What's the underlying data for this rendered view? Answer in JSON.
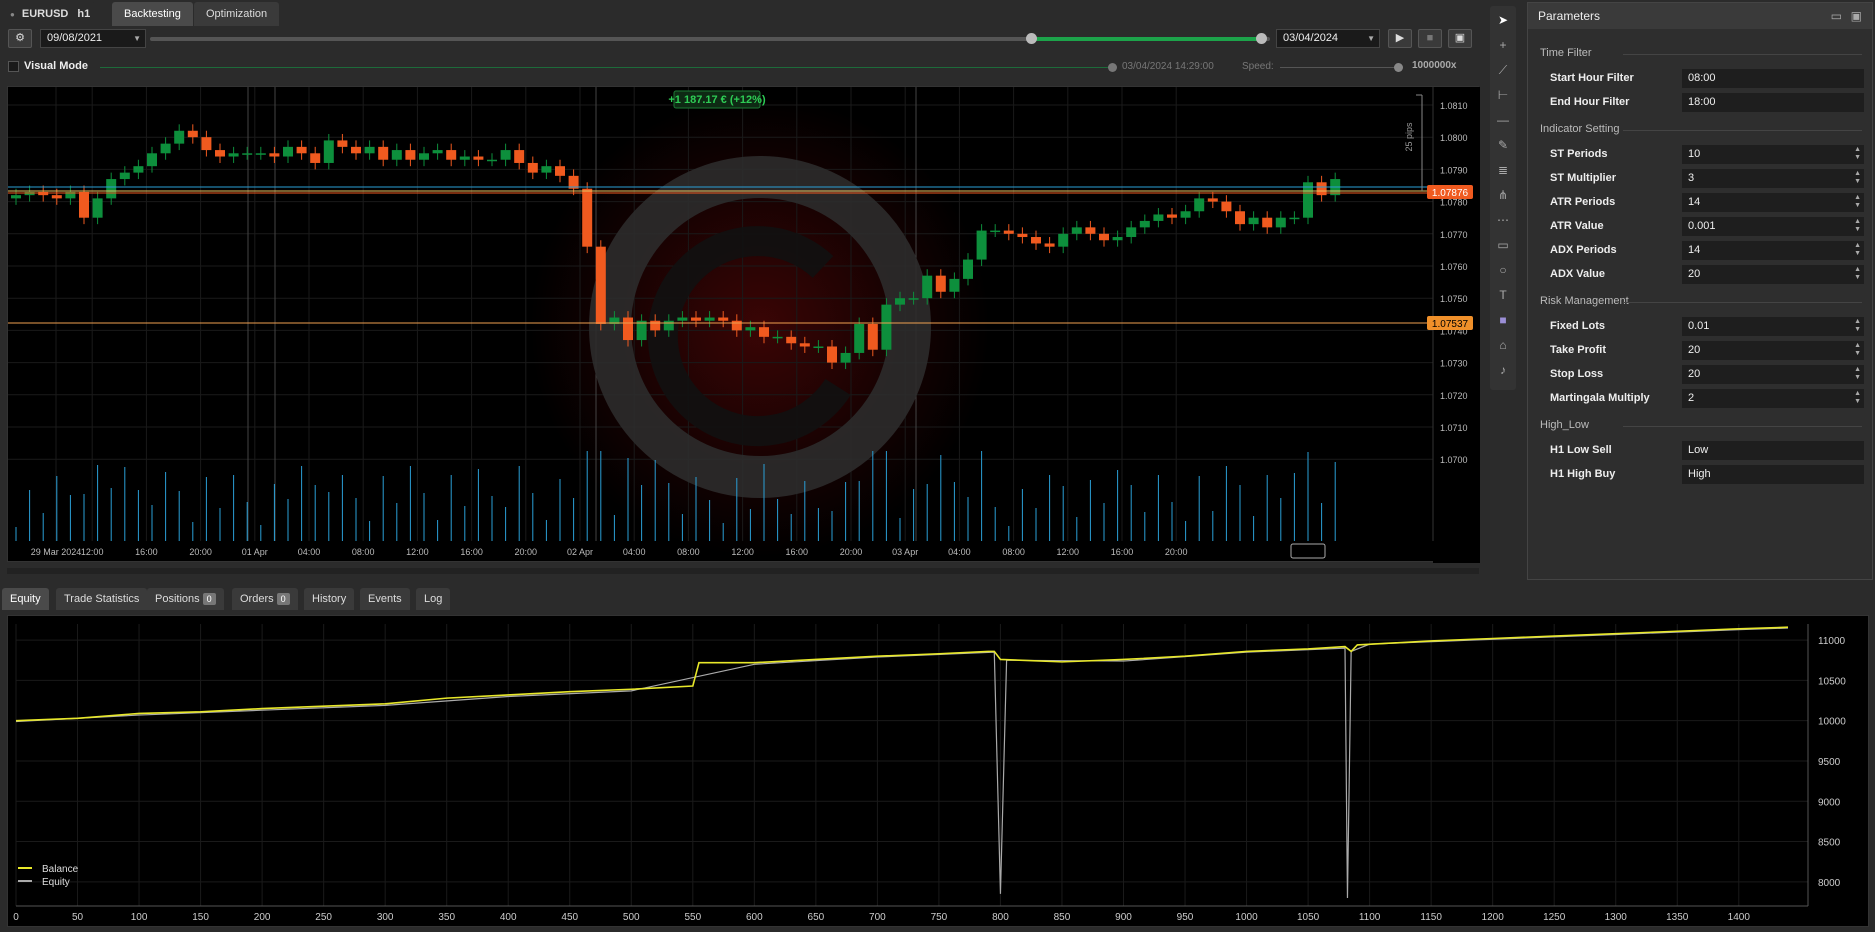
{
  "tabs": {
    "symbol": "EURUSD",
    "timeframe": "h1",
    "backtesting": "Backtesting",
    "optimization": "Optimization"
  },
  "toolbar": {
    "start_date": "09/08/2021",
    "end_date": "03/04/2024",
    "play": "▶",
    "stop": "■",
    "save": "💾"
  },
  "visual": {
    "label": "Visual Mode",
    "timestamp": "03/04/2024 14:29:00",
    "speed_label": "Speed:",
    "speed_value": "1000000x"
  },
  "chart": {
    "profit_label": "+1 187.17 € (+12%)",
    "pips_label": "25 pips",
    "price_tag_current": "1.07876",
    "price_tag_order": "1.07537",
    "price_ticks": [
      "1.0810",
      "1.0800",
      "1.0790",
      "1.0780",
      "1.0770",
      "1.0760",
      "1.0750",
      "1.0740",
      "1.0730",
      "1.0720",
      "1.0710",
      "1.0700"
    ],
    "time_ticks": [
      "29 Mar 2024",
      "12:00",
      "16:00",
      "20:00",
      "01 Apr",
      "04:00",
      "08:00",
      "12:00",
      "16:00",
      "20:00",
      "02 Apr",
      "04:00",
      "08:00",
      "12:00",
      "16:00",
      "20:00",
      "03 Apr",
      "04:00",
      "08:00",
      "12:00",
      "16:00",
      "20:00"
    ],
    "colors": {
      "bull": "#0d8f3c",
      "bear": "#f05a1f",
      "volume": "#2a9fd6",
      "price_line": "#f05a1f"
    }
  },
  "bottom_tabs": [
    {
      "label": "Equity",
      "badge": ""
    },
    {
      "label": "Trade Statistics",
      "badge": ""
    },
    {
      "label": "Positions",
      "badge": "0"
    },
    {
      "label": "Orders",
      "badge": "0"
    },
    {
      "label": "History",
      "badge": ""
    },
    {
      "label": "Events",
      "badge": ""
    },
    {
      "label": "Log",
      "badge": ""
    }
  ],
  "chart_data": {
    "type": "line",
    "xlim": [
      0,
      1440
    ],
    "ylim": [
      7700,
      11200
    ],
    "x_ticks": [
      0,
      50,
      100,
      150,
      200,
      250,
      300,
      350,
      400,
      450,
      500,
      550,
      600,
      650,
      700,
      750,
      800,
      850,
      900,
      950,
      1000,
      1050,
      1100,
      1150,
      1200,
      1250,
      1300,
      1350,
      1400
    ],
    "y_ticks": [
      8000,
      8500,
      9000,
      9500,
      10000,
      10500,
      11000
    ],
    "legend_position": "bottom-left",
    "grid": true,
    "series": [
      {
        "name": "Balance",
        "color": "#e8e82a",
        "x": [
          0,
          50,
          100,
          150,
          200,
          250,
          300,
          350,
          400,
          450,
          500,
          550,
          555,
          600,
          650,
          700,
          750,
          790,
          795,
          800,
          850,
          900,
          950,
          1000,
          1050,
          1080,
          1085,
          1090,
          1150,
          1200,
          1250,
          1300,
          1350,
          1400,
          1440
        ],
        "y": [
          10000,
          10030,
          10090,
          10110,
          10150,
          10180,
          10210,
          10280,
          10320,
          10360,
          10390,
          10430,
          10720,
          10720,
          10760,
          10800,
          10830,
          10860,
          10860,
          10760,
          10730,
          10760,
          10800,
          10860,
          10890,
          10920,
          10860,
          10940,
          10990,
          11020,
          11050,
          11080,
          11110,
          11140,
          11160
        ]
      },
      {
        "name": "Equity",
        "color": "#aaaaaa",
        "x": [
          0,
          100,
          200,
          300,
          400,
          500,
          600,
          700,
          795,
          800,
          805,
          900,
          1000,
          1080,
          1082,
          1085,
          1100,
          1200,
          1300,
          1400,
          1440
        ],
        "y": [
          9990,
          10070,
          10130,
          10190,
          10300,
          10370,
          10700,
          10790,
          10850,
          7850,
          10750,
          10740,
          10850,
          10900,
          7800,
          10860,
          10950,
          11010,
          11070,
          11130,
          11150
        ]
      }
    ]
  },
  "tools": [
    "cursor-icon",
    "crosshair-icon",
    "trendline-icon",
    "ray-icon",
    "horizontal-line-icon",
    "pencil-icon",
    "fibonacci-icon",
    "pitchfork-icon",
    "grid-icon",
    "rectangle-icon",
    "ellipse-icon",
    "text-icon",
    "color-icon",
    "camera-icon",
    "bell-icon"
  ],
  "params": {
    "title": "Parameters",
    "groups": [
      {
        "name": "Time Filter",
        "rows": [
          {
            "label": "Start Hour Filter",
            "value": "08:00"
          },
          {
            "label": "End Hour Filter",
            "value": "18:00"
          }
        ]
      },
      {
        "name": "Indicator Setting",
        "rows": [
          {
            "label": "ST Periods",
            "value": "10",
            "spin": true
          },
          {
            "label": "ST Multiplier",
            "value": "3",
            "spin": true
          },
          {
            "label": "ATR Periods",
            "value": "14",
            "spin": true
          },
          {
            "label": "ATR Value",
            "value": "0.001",
            "spin": true
          },
          {
            "label": "ADX Periods",
            "value": "14",
            "spin": true
          },
          {
            "label": "ADX Value",
            "value": "20",
            "spin": true
          }
        ]
      },
      {
        "name": "Risk Management",
        "rows": [
          {
            "label": "Fixed Lots",
            "value": "0.01",
            "spin": true
          },
          {
            "label": "Take Profit",
            "value": "20",
            "spin": true
          },
          {
            "label": "Stop Loss",
            "value": "20",
            "spin": true
          },
          {
            "label": "Martingala Multiply",
            "value": "2",
            "spin": true
          }
        ]
      },
      {
        "name": "High_Low",
        "rows": [
          {
            "label": "H1 Low Sell",
            "value": "Low"
          },
          {
            "label": "H1 High Buy",
            "value": "High"
          }
        ]
      }
    ]
  }
}
